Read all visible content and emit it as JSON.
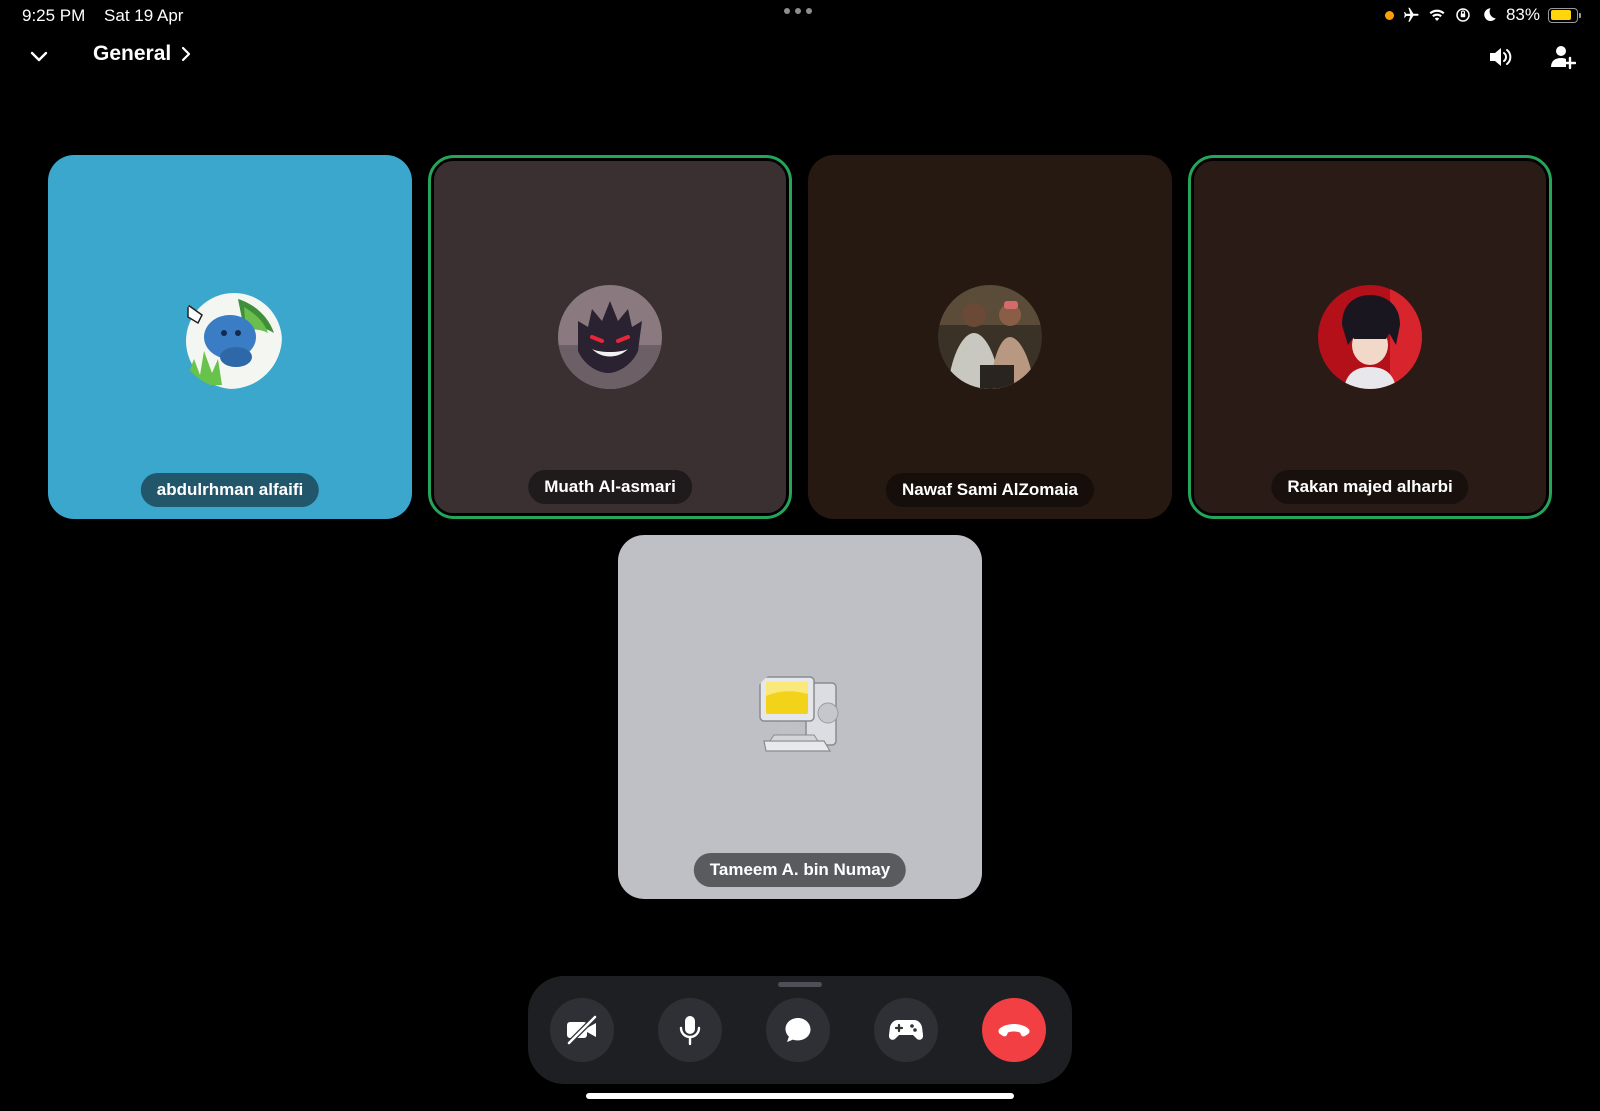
{
  "status_bar": {
    "time": "9:25 PM",
    "date": "Sat 19 Apr",
    "battery_percent": "83%",
    "battery_level": 0.83,
    "icons": [
      "orange-dot",
      "airplane-icon",
      "wifi-icon",
      "orientation-lock-icon",
      "moon-icon",
      "battery-icon"
    ]
  },
  "header": {
    "channel_name": "General",
    "icons": [
      "chevron-down-icon",
      "chevron-right-icon",
      "speaker-icon",
      "add-person-icon"
    ]
  },
  "participants": [
    {
      "name": "abdulrhman alfaifi",
      "tile_color": "#3ba7cc",
      "pill_color": "#22566b",
      "speaking": false,
      "avatar": "blue-character-avatar"
    },
    {
      "name": "Muath Al-asmari",
      "tile_color": "#3a3032",
      "pill_color": "#1f1a1b",
      "speaking": true,
      "avatar": "ghost-avatar"
    },
    {
      "name": "Nawaf Sami AlZomaia",
      "tile_color": "#251912",
      "pill_color": "#150e0a",
      "speaking": false,
      "avatar": "photo-avatar"
    },
    {
      "name": "Rakan majed alharbi",
      "tile_color": "#2a1b17",
      "pill_color": "#18100d",
      "speaking": true,
      "avatar": "anime-avatar"
    },
    {
      "name": "Tameem A. bin Numay",
      "tile_color": "#bfc0c6",
      "pill_color": "#5a5b5f",
      "speaking": false,
      "avatar": "computer-avatar"
    }
  ],
  "controls": {
    "buttons": [
      "camera-off-icon",
      "microphone-icon",
      "chat-icon",
      "gamepad-icon",
      "end-call-icon"
    ],
    "accent_speaking": "#23a55a",
    "end_call_color": "#f23f43"
  }
}
